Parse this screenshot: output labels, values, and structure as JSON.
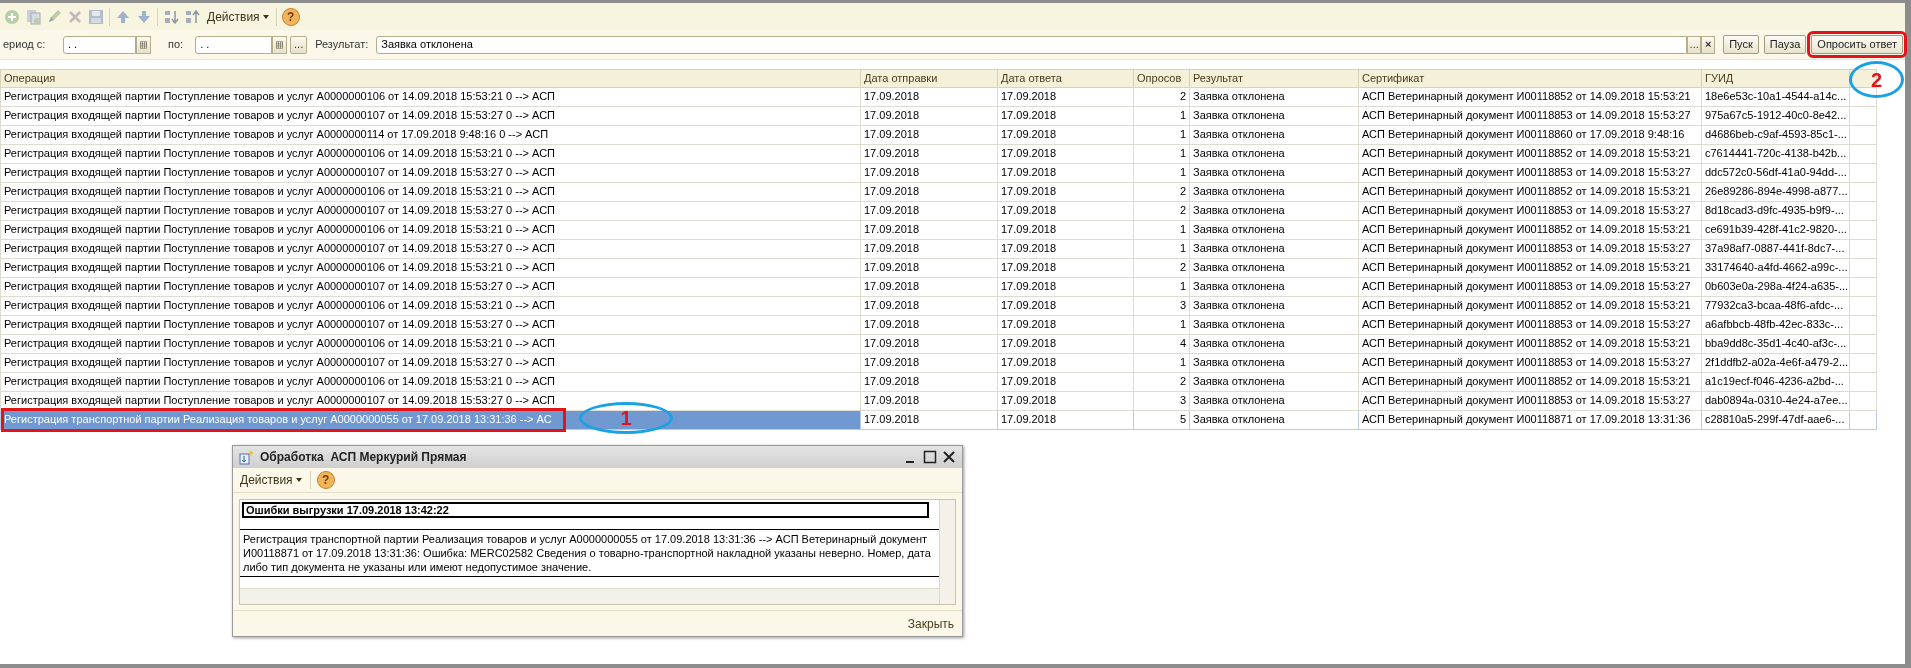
{
  "toolbar": {
    "actions_menu": "Действия",
    "help_glyph": "?"
  },
  "filters": {
    "period_from_label": "ериод с:",
    "period_from_value": ". .",
    "period_to_label": "по:",
    "period_to_value": ". .",
    "period_select_button": "...",
    "result_label": "Результат:",
    "result_value": "Заявка отклонена",
    "result_select_button": "...",
    "result_clear_button": "×"
  },
  "buttons": [
    {
      "label": "Пуск",
      "highlighted": false
    },
    {
      "label": "Пауза",
      "highlighted": false
    },
    {
      "label": "Опросить ответ",
      "highlighted": true
    }
  ],
  "table": {
    "columns": [
      "Операция",
      "Дата отправки",
      "Дата ответа",
      "Опросов",
      "Результат",
      "Сертификат",
      "ГУИД"
    ],
    "rows": [
      {
        "operation": "Регистрация входящей партии Поступление товаров и услуг А0000000106 от 14.09.2018 15:53:21 0 --> АСП",
        "sent": "17.09.2018",
        "answered": "17.09.2018",
        "polls": "2",
        "result": "Заявка отклонена",
        "certificate": "АСП Ветеринарный документ И00118852 от 14.09.2018 15:53:21",
        "guid": "18e6e53c-10a1-4544-a14c...",
        "selected": false,
        "highlighted": false
      },
      {
        "operation": "Регистрация входящей партии Поступление товаров и услуг А0000000107 от 14.09.2018 15:53:27 0 --> АСП",
        "sent": "17.09.2018",
        "answered": "17.09.2018",
        "polls": "1",
        "result": "Заявка отклонена",
        "certificate": "АСП Ветеринарный документ И00118853 от 14.09.2018 15:53:27",
        "guid": "975a67c5-1912-40c0-8e42...",
        "selected": false,
        "highlighted": false
      },
      {
        "operation": "Регистрация входящей партии Поступление товаров и услуг А0000000114 от 17.09.2018 9:48:16 0 --> АСП",
        "sent": "17.09.2018",
        "answered": "17.09.2018",
        "polls": "1",
        "result": "Заявка отклонена",
        "certificate": "АСП Ветеринарный документ И00118860 от 17.09.2018 9:48:16",
        "guid": "d4686beb-c9af-4593-85c1-...",
        "selected": false,
        "highlighted": false
      },
      {
        "operation": "Регистрация входящей партии Поступление товаров и услуг А0000000106 от 14.09.2018 15:53:21 0 --> АСП",
        "sent": "17.09.2018",
        "answered": "17.09.2018",
        "polls": "1",
        "result": "Заявка отклонена",
        "certificate": "АСП Ветеринарный документ И00118852 от 14.09.2018 15:53:21",
        "guid": "c7614441-720c-4138-b42b...",
        "selected": false,
        "highlighted": false
      },
      {
        "operation": "Регистрация входящей партии Поступление товаров и услуг А0000000107 от 14.09.2018 15:53:27 0 --> АСП",
        "sent": "17.09.2018",
        "answered": "17.09.2018",
        "polls": "1",
        "result": "Заявка отклонена",
        "certificate": "АСП Ветеринарный документ И00118853 от 14.09.2018 15:53:27",
        "guid": "ddc572c0-56df-41a0-94dd-...",
        "selected": false,
        "highlighted": false
      },
      {
        "operation": "Регистрация входящей партии Поступление товаров и услуг А0000000106 от 14.09.2018 15:53:21 0 --> АСП",
        "sent": "17.09.2018",
        "answered": "17.09.2018",
        "polls": "2",
        "result": "Заявка отклонена",
        "certificate": "АСП Ветеринарный документ И00118852 от 14.09.2018 15:53:21",
        "guid": "26e89286-894e-4998-a877...",
        "selected": false,
        "highlighted": false
      },
      {
        "operation": "Регистрация входящей партии Поступление товаров и услуг А0000000107 от 14.09.2018 15:53:27 0 --> АСП",
        "sent": "17.09.2018",
        "answered": "17.09.2018",
        "polls": "2",
        "result": "Заявка отклонена",
        "certificate": "АСП Ветеринарный документ И00118853 от 14.09.2018 15:53:27",
        "guid": "8d18cad3-d9fc-4935-b9f9-...",
        "selected": false,
        "highlighted": false
      },
      {
        "operation": "Регистрация входящей партии Поступление товаров и услуг А0000000106 от 14.09.2018 15:53:21 0 --> АСП",
        "sent": "17.09.2018",
        "answered": "17.09.2018",
        "polls": "1",
        "result": "Заявка отклонена",
        "certificate": "АСП Ветеринарный документ И00118852 от 14.09.2018 15:53:21",
        "guid": "ce691b39-428f-41c2-9820-...",
        "selected": false,
        "highlighted": false
      },
      {
        "operation": "Регистрация входящей партии Поступление товаров и услуг А0000000107 от 14.09.2018 15:53:27 0 --> АСП",
        "sent": "17.09.2018",
        "answered": "17.09.2018",
        "polls": "1",
        "result": "Заявка отклонена",
        "certificate": "АСП Ветеринарный документ И00118853 от 14.09.2018 15:53:27",
        "guid": "37a98af7-0887-441f-8dc7-...",
        "selected": false,
        "highlighted": false
      },
      {
        "operation": "Регистрация входящей партии Поступление товаров и услуг А0000000106 от 14.09.2018 15:53:21 0 --> АСП",
        "sent": "17.09.2018",
        "answered": "17.09.2018",
        "polls": "2",
        "result": "Заявка отклонена",
        "certificate": "АСП Ветеринарный документ И00118852 от 14.09.2018 15:53:21",
        "guid": "33174640-a4fd-4662-a99c-...",
        "selected": false,
        "highlighted": false
      },
      {
        "operation": "Регистрация входящей партии Поступление товаров и услуг А0000000107 от 14.09.2018 15:53:27 0 --> АСП",
        "sent": "17.09.2018",
        "answered": "17.09.2018",
        "polls": "1",
        "result": "Заявка отклонена",
        "certificate": "АСП Ветеринарный документ И00118853 от 14.09.2018 15:53:27",
        "guid": "0b603e0a-298a-4f24-a635-...",
        "selected": false,
        "highlighted": false
      },
      {
        "operation": "Регистрация входящей партии Поступление товаров и услуг А0000000106 от 14.09.2018 15:53:21 0 --> АСП",
        "sent": "17.09.2018",
        "answered": "17.09.2018",
        "polls": "3",
        "result": "Заявка отклонена",
        "certificate": "АСП Ветеринарный документ И00118852 от 14.09.2018 15:53:21",
        "guid": "77932ca3-bcaa-48f6-afdc-...",
        "selected": false,
        "highlighted": false
      },
      {
        "operation": "Регистрация входящей партии Поступление товаров и услуг А0000000107 от 14.09.2018 15:53:27 0 --> АСП",
        "sent": "17.09.2018",
        "answered": "17.09.2018",
        "polls": "1",
        "result": "Заявка отклонена",
        "certificate": "АСП Ветеринарный документ И00118853 от 14.09.2018 15:53:27",
        "guid": "a6afbbcb-48fb-42ec-833c-...",
        "selected": false,
        "highlighted": false
      },
      {
        "operation": "Регистрация входящей партии Поступление товаров и услуг А0000000106 от 14.09.2018 15:53:21 0 --> АСП",
        "sent": "17.09.2018",
        "answered": "17.09.2018",
        "polls": "4",
        "result": "Заявка отклонена",
        "certificate": "АСП Ветеринарный документ И00118852 от 14.09.2018 15:53:21",
        "guid": "bba9dd8c-35d1-4c40-af3c-...",
        "selected": false,
        "highlighted": false
      },
      {
        "operation": "Регистрация входящей партии Поступление товаров и услуг А0000000107 от 14.09.2018 15:53:27 0 --> АСП",
        "sent": "17.09.2018",
        "answered": "17.09.2018",
        "polls": "1",
        "result": "Заявка отклонена",
        "certificate": "АСП Ветеринарный документ И00118853 от 14.09.2018 15:53:27",
        "guid": "2f1ddfb2-a02a-4e6f-a479-2...",
        "selected": false,
        "highlighted": false
      },
      {
        "operation": "Регистрация входящей партии Поступление товаров и услуг А0000000106 от 14.09.2018 15:53:21 0 --> АСП",
        "sent": "17.09.2018",
        "answered": "17.09.2018",
        "polls": "2",
        "result": "Заявка отклонена",
        "certificate": "АСП Ветеринарный документ И00118852 от 14.09.2018 15:53:21",
        "guid": "a1c19ecf-f046-4236-a2bd-...",
        "selected": false,
        "highlighted": false
      },
      {
        "operation": "Регистрация входящей партии Поступление товаров и услуг А0000000107 от 14.09.2018 15:53:27 0 --> АСП",
        "sent": "17.09.2018",
        "answered": "17.09.2018",
        "polls": "3",
        "result": "Заявка отклонена",
        "certificate": "АСП Ветеринарный документ И00118853 от 14.09.2018 15:53:27",
        "guid": "dab0894a-0310-4e24-a7ee...",
        "selected": false,
        "highlighted": false
      },
      {
        "operation": "Регистрация транспортной партии Реализация товаров и услуг А0000000055 от 17.09.2018 13:31:36 --> АС",
        "sent": "17.09.2018",
        "answered": "17.09.2018",
        "polls": "5",
        "result": "Заявка отклонена",
        "certificate": "АСП Ветеринарный документ И00118871 от 17.09.2018 13:31:36",
        "guid": "c28810a5-299f-47df-aae6-...",
        "selected": true,
        "highlighted": true
      }
    ]
  },
  "callouts": [
    {
      "number": "1"
    },
    {
      "number": "2"
    }
  ],
  "dialog": {
    "title": "Обработка  АСП Меркурий Прямая",
    "actions_menu": "Действия",
    "help_glyph": "?",
    "heading": "Ошибки выгрузки 17.09.2018 13:42:22",
    "message": "Регистрация транспортной партии Реализация товаров и услуг А0000000055 от 17.09.2018 13:31:36 --> АСП Ветеринарный документ И00118871 от 17.09.2018 13:31:36: Ошибка: MERC02582 Сведения о товарно-транспортной накладной указаны неверно. Номер, дата либо тип документа не указаны или имеют недопустимое значение.",
    "close_button": "Закрыть"
  }
}
